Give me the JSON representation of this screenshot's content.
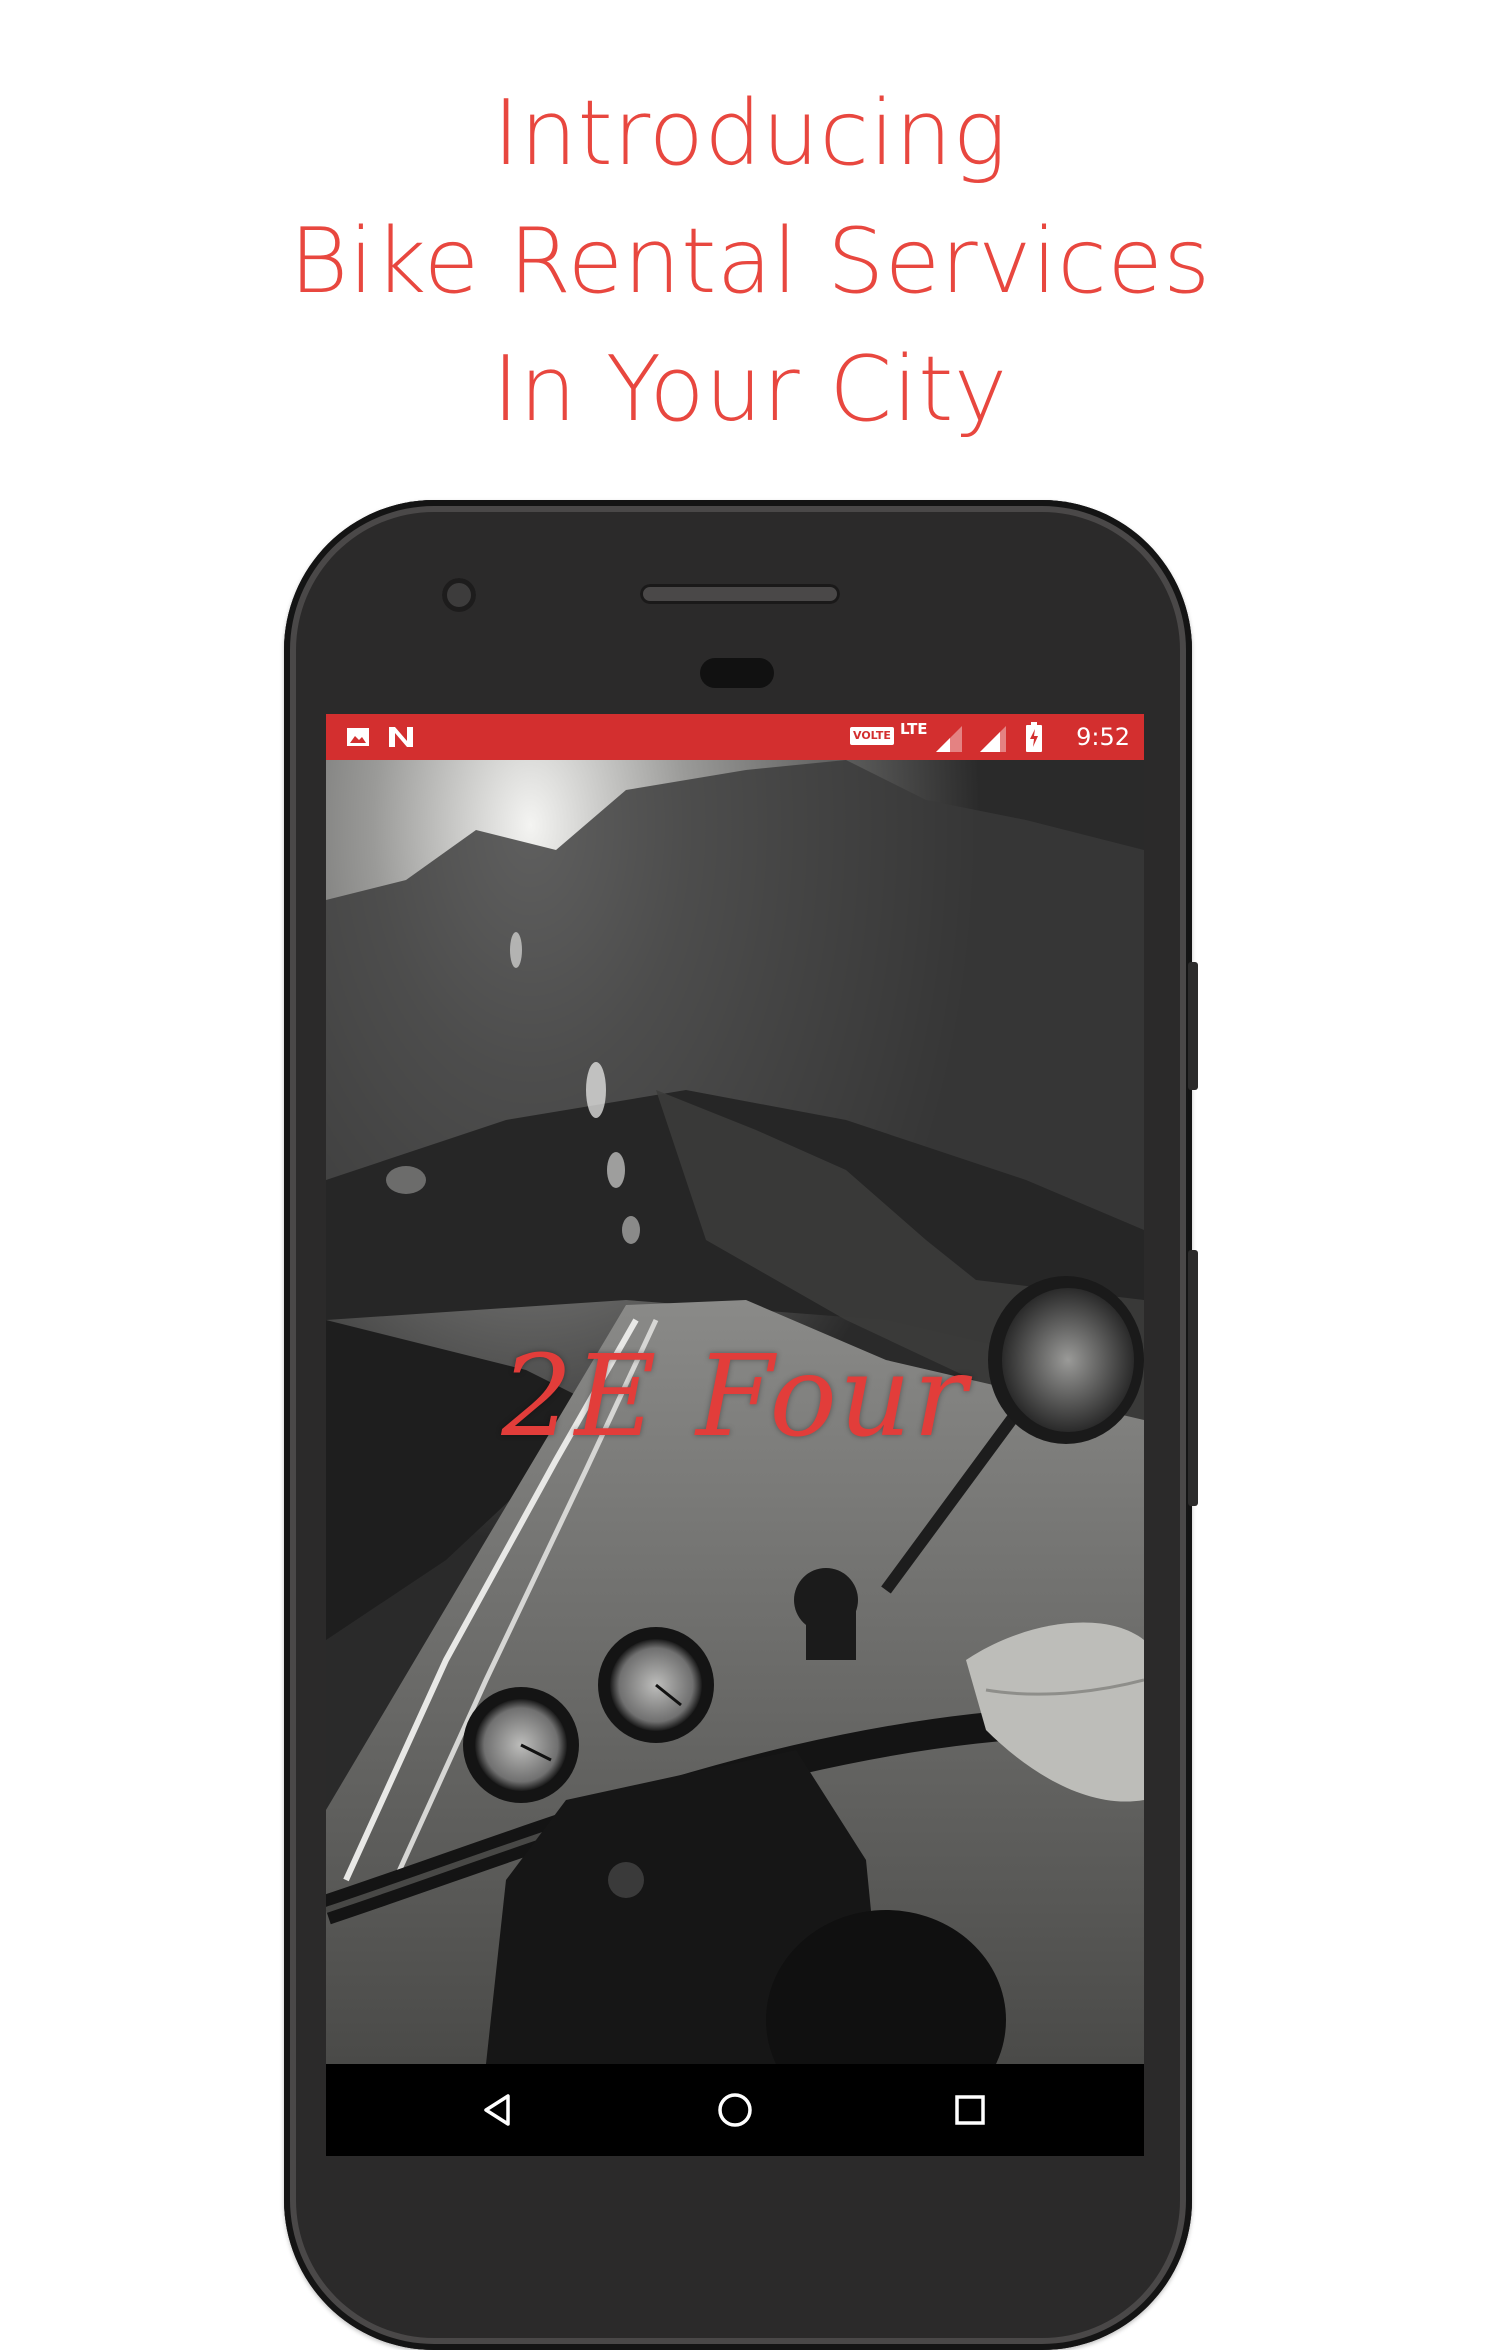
{
  "headline": {
    "line1": "Introducing",
    "line2": "Bike Rental Services",
    "line3": "In Your City"
  },
  "colors": {
    "accent": "#e8473f",
    "statusbar": "#d32f2f",
    "phone_body": "#2b2a2a"
  },
  "statusbar": {
    "left_icons": [
      "image-icon",
      "n-notification-icon"
    ],
    "volte": "VOLTE",
    "lte": "LTE",
    "right_icons": [
      "signal-icon",
      "signal-icon",
      "battery-charging-icon"
    ],
    "time": "9:52"
  },
  "app": {
    "brand_name": "2E Four",
    "background_image": "vintage motorcycle handlebar view on winding mountain road"
  },
  "navbar": {
    "buttons": [
      "back-icon",
      "home-icon",
      "recents-icon"
    ]
  }
}
